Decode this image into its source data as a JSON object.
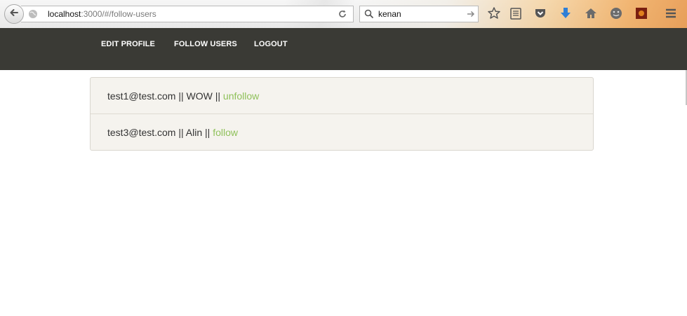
{
  "browser": {
    "url_host": "localhost",
    "url_rest": ":3000/#/follow-users",
    "search_value": "kenan",
    "icons": [
      "back-arrow-icon",
      "globe-icon",
      "reload-icon",
      "search-icon",
      "go-arrow-icon",
      "bookmark-star-icon",
      "reading-list-icon",
      "pocket-icon",
      "download-icon",
      "home-icon",
      "emoji-icon",
      "extension-icon",
      "menu-icon"
    ]
  },
  "nav": {
    "links": [
      "EDIT PROFILE",
      "FOLLOW USERS",
      "LOGOUT"
    ],
    "background": "#3a3a35"
  },
  "users": [
    {
      "email": "test1@test.com",
      "separator": "||",
      "name": "WOW",
      "action": "unfollow"
    },
    {
      "email": "test3@test.com",
      "separator": "||",
      "name": "Alin",
      "action": "follow"
    }
  ],
  "colors": {
    "action_link": "#8fc15a",
    "panel_bg": "#f5f3ee"
  }
}
